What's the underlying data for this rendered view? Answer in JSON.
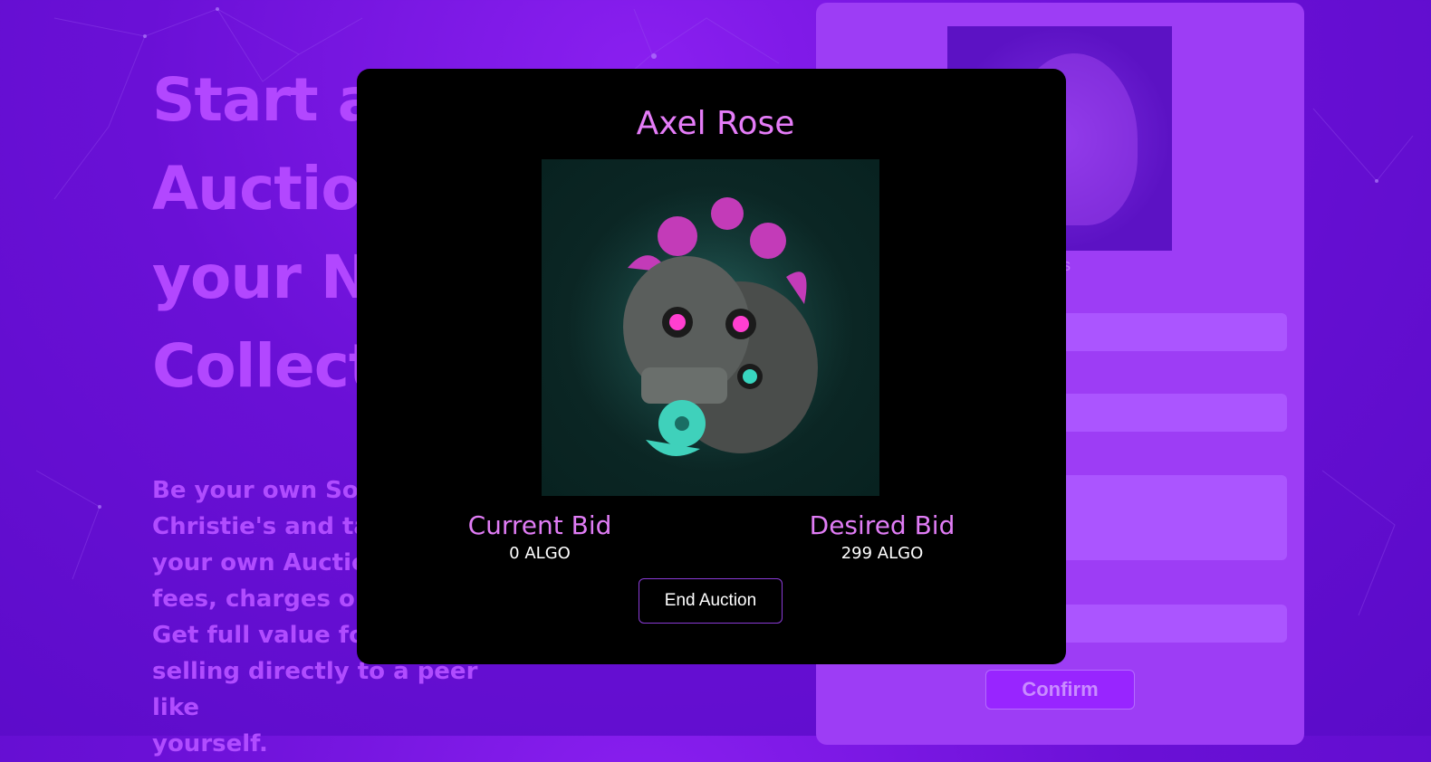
{
  "hero": {
    "title_lines": [
      "Start a",
      "Auctio",
      "your N",
      "Collect"
    ],
    "text_lines": [
      "Be your own Sot",
      "Christie's and tal",
      "your own Auctic",
      "fees, charges or",
      "Get full value fo",
      "selling directly to a peer like",
      "yourself."
    ]
  },
  "form_panel": {
    "caption": "ble for image NFTs",
    "confirm_label": "Confirm"
  },
  "modal": {
    "title": "Axel Rose",
    "current_bid_label": "Current Bid",
    "current_bid_value": "0 ALGO",
    "desired_bid_label": "Desired Bid",
    "desired_bid_value": "299 ALGO",
    "end_button_label": "End Auction"
  },
  "colors": {
    "background": "#6a10d6",
    "accent_text": "#b247ff",
    "modal_title": "#e57cf8",
    "button_border": "#8a3bd6"
  },
  "icons": {
    "nft_art": "skull-with-flowers-artwork"
  }
}
